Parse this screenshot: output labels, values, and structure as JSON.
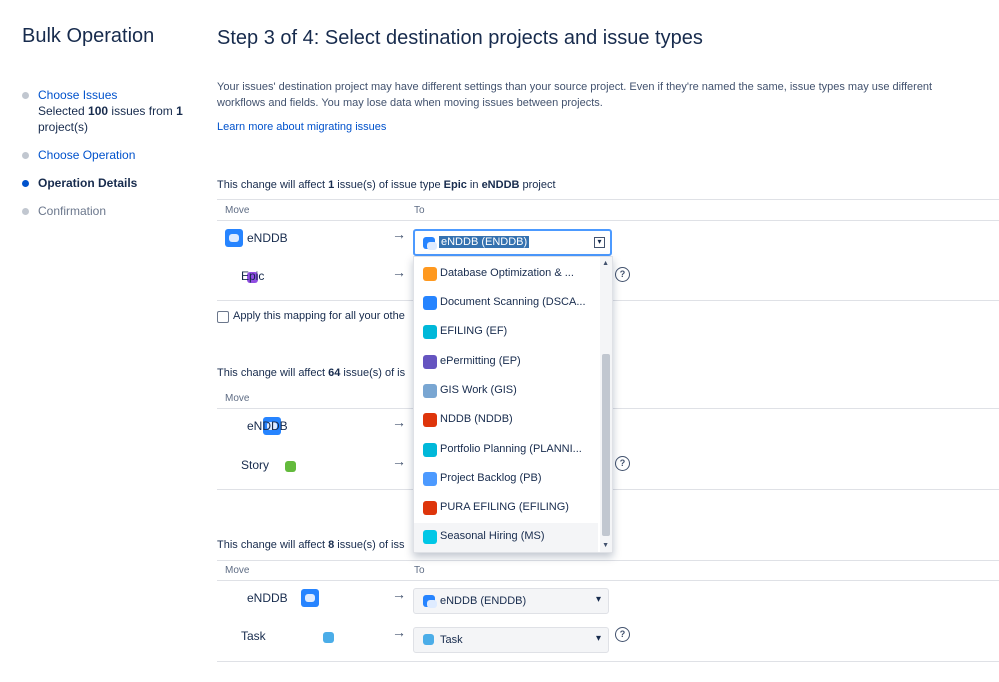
{
  "sidebar": {
    "title": "Bulk Operation",
    "steps": [
      {
        "label": "Choose Issues",
        "sub1": "Selected ",
        "sub_count": "100",
        "sub2": " issues from ",
        "sub_proj": "1",
        "sub3": "project(s)"
      },
      {
        "label": "Choose Operation"
      },
      {
        "label": "Operation Details"
      },
      {
        "label": "Confirmation"
      }
    ]
  },
  "main": {
    "title": "Step 3 of 4: Select destination projects and issue types",
    "description": "Your issues' destination project may have different settings than your source project. Even if they're named the same, issue types may use different workflows and fields. You may lose data when moving issues between projects.",
    "learn_more": "Learn more about migrating issues"
  },
  "columns": {
    "move": "Move",
    "to": "To"
  },
  "sections": [
    {
      "head_prefix": "This change will affect ",
      "count": "1",
      "head_mid": " issue(s) of issue type ",
      "issue_type": "Epic",
      "head_in": " in ",
      "project": "eNDDB",
      "head_suffix": " project",
      "source_project": "eNDDB",
      "source_type": "Epic",
      "dest_project": "eNDDB (ENDDB)",
      "apply_label": "Apply this mapping for all your othe"
    },
    {
      "head_prefix": "This change will affect ",
      "count": "64",
      "head_mid": " issue(s) of is",
      "source_project": "eNDDB",
      "source_type": "Story"
    },
    {
      "head_prefix": "This change will affect ",
      "count": "8",
      "head_mid": " issue(s) of iss",
      "source_project": "eNDDB",
      "source_type": "Task",
      "dest_project": "eNDDB (ENDDB)",
      "dest_type": "Task"
    }
  ],
  "dropdown": {
    "items": [
      {
        "label": "Database Optimization & ...",
        "color": "#ff991f"
      },
      {
        "label": "Document Scanning (DSCA...",
        "color": "#2684ff"
      },
      {
        "label": "EFILING (EF)",
        "color": "#00b8d9"
      },
      {
        "label": "ePermitting (EP)",
        "color": "#6554c0"
      },
      {
        "label": "GIS Work (GIS)",
        "color": "#79a6d2"
      },
      {
        "label": "NDDB (NDDB)",
        "color": "#de350b"
      },
      {
        "label": "Portfolio Planning (PLANNI...",
        "color": "#00b8d9"
      },
      {
        "label": "Project Backlog (PB)",
        "color": "#4c9aff"
      },
      {
        "label": "PURA EFILING (EFILING)",
        "color": "#de350b"
      },
      {
        "label": "Seasonal Hiring (MS)",
        "color": "#00c7e6"
      }
    ]
  },
  "icons": {
    "project": "project-avatar-icon",
    "epic": "epic-icon",
    "story": "story-icon",
    "task": "task-icon",
    "arrow": "→",
    "help": "?",
    "chevron": "⌄"
  },
  "colors": {
    "link": "#0052cc",
    "epic": "#904ee2",
    "story": "#63ba3c",
    "task": "#4bade8",
    "focus": "#4c9aff"
  }
}
